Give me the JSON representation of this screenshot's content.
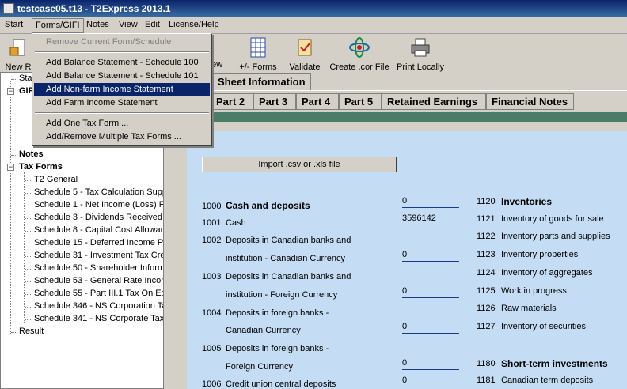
{
  "window": {
    "title": "testcase05.t13 - T2Express 2013.1"
  },
  "menubar": {
    "items": [
      "Start",
      "Forms/GIFI",
      "Notes",
      "View",
      "Edit",
      "License/Help"
    ]
  },
  "toolbar": {
    "new_label": "New R",
    "view_label": "iew",
    "forms_label": "+/- Forms",
    "validate_label": "Validate",
    "create_label": "Create .cor File",
    "print_label": "Print Locally"
  },
  "dropdown": {
    "items": [
      "Remove Current Form/Schedule",
      "Add Balance Statement - Schedule 100",
      "Add Balance Statement - Schedule 101",
      "Add Non-farm Income Statement",
      "Add Farm Income Statement",
      "Add One Tax Form ...",
      "Add/Remove Multiple Tax Forms ..."
    ]
  },
  "tree": {
    "sta": "Sta",
    "gif": "GIF",
    "notes": "Notes",
    "tax_forms": "Tax Forms",
    "items": [
      "T2 General",
      "Schedule 5 - Tax Calculation Supp",
      "Schedule 1 - Net Income (Loss) Fo",
      "Schedule 3 - Dividends Received,",
      "Schedule 8 - Capital Cost Allowan",
      "Schedule 15 - Deferred Income Pla",
      "Schedule 31 - Investment Tax Cre",
      "Schedule 50 - Shareholder Inform",
      "Schedule 53 - General Rate Incom",
      "Schedule 55 - Part III.1 Tax On E:",
      "Schedule 346 - NS Corporation Ta",
      "Schedule 341 - NS Corporate Tax"
    ],
    "result": "Result"
  },
  "tabs": {
    "top": "Sheet Information",
    "parts": [
      "Part 2",
      "Part 3",
      "Part 4",
      "Part 5",
      "Retained Earnings",
      "Financial Notes"
    ]
  },
  "form": {
    "import_label": "Import .csv or .xls file",
    "left": [
      {
        "code": "1000",
        "label": "Cash and deposits",
        "value": "0"
      },
      {
        "code": "1001",
        "label": "Cash",
        "value": "3596142"
      },
      {
        "code": "1002",
        "label": "Deposits in Canadian banks and",
        "label2": "institution - Canadian Currency",
        "value": "0"
      },
      {
        "code": "1003",
        "label": "Deposits in Canadian banks and",
        "label2": "institution - Foreign Currency",
        "value": "0"
      },
      {
        "code": "1004",
        "label": "Deposits in foreign banks -",
        "label2": "Canadian Currency",
        "value": "0"
      },
      {
        "code": "1005",
        "label": "Deposits in foreign banks -",
        "label2": "Foreign Currency",
        "value": "0"
      },
      {
        "code": "1006",
        "label": "Credit union central deposits",
        "value": "0"
      }
    ],
    "right": [
      {
        "code": "1120",
        "label": "Inventories"
      },
      {
        "code": "1121",
        "label": "Inventory of goods for sale"
      },
      {
        "code": "1122",
        "label": "Inventory parts and supplies"
      },
      {
        "code": "1123",
        "label": "Inventory properties"
      },
      {
        "code": "1124",
        "label": "Inventory of aggregates"
      },
      {
        "code": "1125",
        "label": "Work in progress"
      },
      {
        "code": "1126",
        "label": "Raw materials"
      },
      {
        "code": "1127",
        "label": "Inventory of securities"
      },
      {
        "code": "1180",
        "label": "Short-term investments"
      },
      {
        "code": "1181",
        "label": "Canadian term deposits"
      }
    ]
  }
}
